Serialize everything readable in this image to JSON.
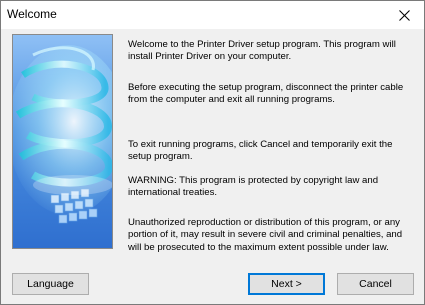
{
  "window": {
    "title": "Welcome"
  },
  "content": {
    "para1": "Welcome to the Printer Driver setup program. This program will install Printer Driver on your computer.",
    "para2": "Before executing the setup program, disconnect the printer cable from the computer and exit all running programs.",
    "para3": "To exit running programs, click Cancel and temporarily exit the setup program.",
    "para4": "WARNING: This program is protected by copyright law and international treaties.",
    "para5": "Unauthorized reproduction or distribution of this program, or any portion of it, may result in severe civil and criminal penalties, and will be prosecuted to the maximum extent possible under law."
  },
  "buttons": {
    "language": "Language",
    "next": "Next >",
    "cancel": "Cancel"
  },
  "colors": {
    "banner_sky": "#5aa0e8",
    "banner_accent": "#2fd0e0",
    "default_button_border": "#0078d7"
  },
  "icons": {
    "close": "close-icon"
  }
}
